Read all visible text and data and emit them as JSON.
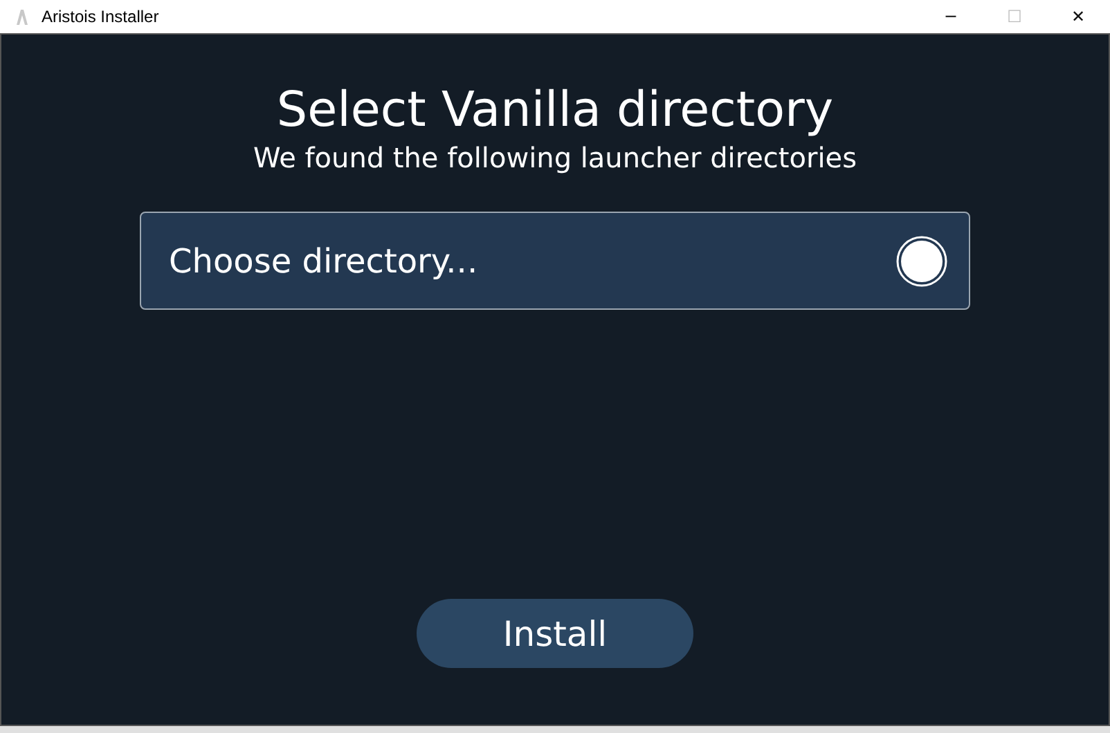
{
  "window": {
    "title": "Aristois Installer",
    "controls": [
      "─",
      "☐",
      "✕"
    ]
  },
  "heading": "Select Vanilla directory",
  "subheading": "We found the following launcher directories",
  "directory_select": {
    "placeholder": "Choose directory..."
  },
  "buttons": [
    "Install"
  ]
}
